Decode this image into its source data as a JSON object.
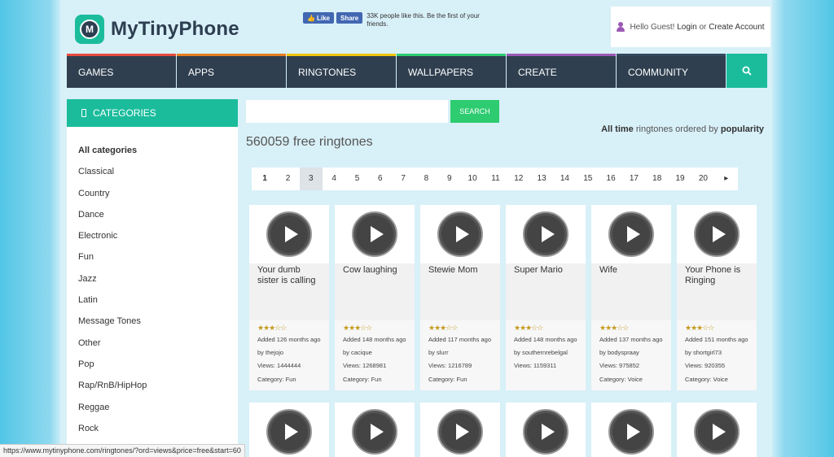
{
  "logo": {
    "text": "MyTinyPhone",
    "badge": "M"
  },
  "facebook": {
    "like": "Like",
    "share": "Share",
    "text": "33K people like this. Be the first of your friends."
  },
  "account": {
    "greeting": "Hello Guest!",
    "login": "Login",
    "or": "or",
    "create": "Create Account"
  },
  "nav": [
    "GAMES",
    "APPS",
    "RINGTONES",
    "WALLPAPERS",
    "CREATE",
    "COMMUNITY"
  ],
  "sidebar": {
    "heading": "CATEGORIES",
    "items": [
      "All categories",
      "Classical",
      "Country",
      "Dance",
      "Electronic",
      "Fun",
      "Jazz",
      "Latin",
      "Message Tones",
      "Other",
      "Pop",
      "Rap/RnB/HipHop",
      "Reggae",
      "Rock"
    ]
  },
  "search": {
    "placeholder": "",
    "button": "SEARCH"
  },
  "order": {
    "period": "All time",
    "middle": "ringtones ordered by",
    "sort": "popularity"
  },
  "count": "560059 free ringtones",
  "pager": [
    "1",
    "2",
    "3",
    "4",
    "5",
    "6",
    "7",
    "8",
    "9",
    "10",
    "11",
    "12",
    "13",
    "14",
    "15",
    "16",
    "17",
    "18",
    "19",
    "20",
    "▸"
  ],
  "ringtones": [
    {
      "title": "Your dumb sister is calling",
      "added": "Added 126 months ago by thejojo",
      "views": "Views: 1444444",
      "category": "Category: Fun"
    },
    {
      "title": "Cow laughing",
      "added": "Added 148 months ago by cacique",
      "views": "Views: 1268981",
      "category": "Category: Fun"
    },
    {
      "title": "Stewie Mom",
      "added": "Added 117 months ago by slurr",
      "views": "Views: 1216789",
      "category": "Category: Fun"
    },
    {
      "title": "Super Mario",
      "added": "Added 148 months ago by southernrebelgal",
      "views": "Views: 1159311",
      "category": ""
    },
    {
      "title": "Wife",
      "added": "Added 137 months ago by bodyspraay",
      "views": "Views: 975852",
      "category": "Category: Voice"
    },
    {
      "title": "Your Phone is Ringing",
      "added": "Added 151 months ago by shortgirl73",
      "views": "Views: 920355",
      "category": "Category: Voice"
    }
  ],
  "rating_stars": "★★★☆☆",
  "statusbar": "https://www.mytinyphone.com/ringtones/?ord=views&price=free&start=60",
  "colors": {
    "accent": "#1abc9c",
    "nav_bg": "#2f3f50",
    "search_btn": "#2ecc71"
  }
}
